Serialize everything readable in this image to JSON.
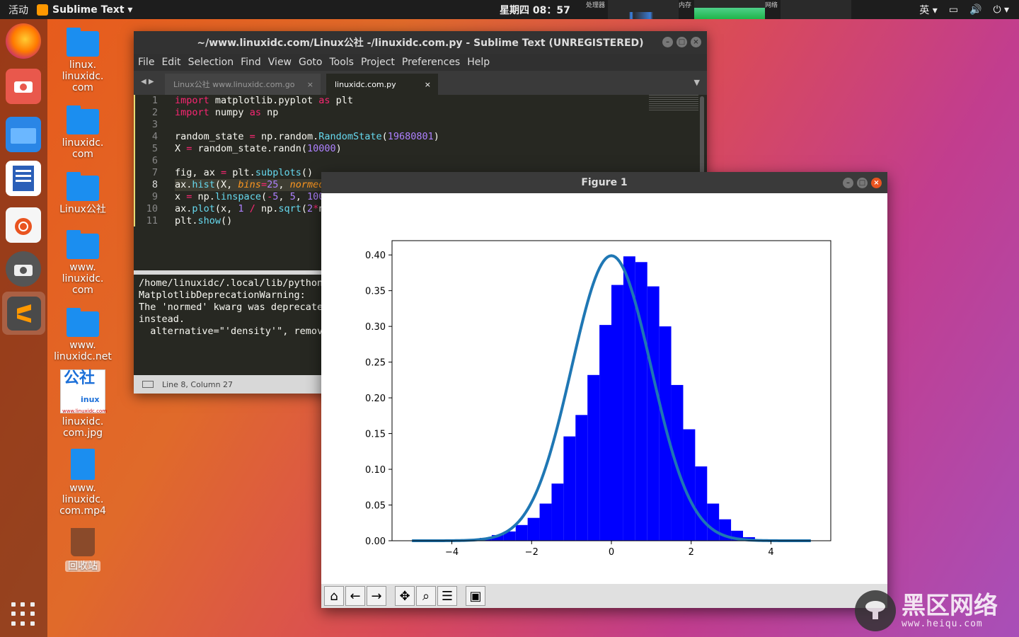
{
  "topbar": {
    "activities": "活动",
    "app_menu": "Sublime Text ▾",
    "clock": "星期四 08：57",
    "monitors": {
      "cpu": "处理器",
      "mem": "内存",
      "net": "网络"
    },
    "input_method": "英 ▾"
  },
  "desktop_icons": [
    {
      "label": "linux.\nlinuxidc.\ncom"
    },
    {
      "label": "linuxidc.\ncom"
    },
    {
      "label": "Linux公社"
    },
    {
      "label": "www.\nlinuxidc.\ncom"
    },
    {
      "label": "www.\nlinuxidc.net"
    },
    {
      "label": "linuxidc.\ncom.jpg"
    },
    {
      "label": "www.\nlinuxidc.\ncom.mp4"
    },
    {
      "label": "回收站"
    }
  ],
  "jpg_thumb": {
    "big": "公社",
    "inux": "inux",
    "url": "www.linuxidc.com"
  },
  "sublime": {
    "title": "~/www.linuxidc.com/Linux公社 -/linuxidc.com.py - Sublime Text (UNREGISTERED)",
    "menu": [
      "File",
      "Edit",
      "Selection",
      "Find",
      "View",
      "Goto",
      "Tools",
      "Project",
      "Preferences",
      "Help"
    ],
    "tabs": [
      {
        "label": "Linux公社 www.linuxidc.com.go"
      },
      {
        "label": "linuxidc.com.py"
      }
    ],
    "line_numbers": [
      "1",
      "2",
      "3",
      "4",
      "5",
      "6",
      "7",
      "8",
      "9",
      "10",
      "11"
    ],
    "console": "/home/linuxidc/.local/lib/python3\nMatplotlibDeprecationWarning:\nThe 'normed' kwarg was deprecated\ninstead.\n  alternative=\"'density'\", remova",
    "status": "Line 8, Column 27"
  },
  "figure": {
    "title": "Figure 1"
  },
  "chart_data": {
    "type": "bar",
    "title": "",
    "xlabel": "",
    "ylabel": "",
    "xlim": [
      -5.5,
      5.5
    ],
    "ylim": [
      0,
      0.42
    ],
    "xticks": [
      -4,
      -2,
      0,
      2,
      4
    ],
    "xtick_labels": [
      "−4",
      "−2",
      "0",
      "2",
      "4"
    ],
    "yticks": [
      0.0,
      0.05,
      0.1,
      0.15,
      0.2,
      0.25,
      0.3,
      0.35,
      0.4
    ],
    "ytick_labels": [
      "0.00",
      "0.05",
      "0.10",
      "0.15",
      "0.20",
      "0.25",
      "0.30",
      "0.35",
      "0.40"
    ],
    "bar_color": "#0000ff",
    "line_color": "#1f77b4",
    "histogram": {
      "bin_start": -3.9,
      "bin_width": 0.3,
      "heights": [
        0.001,
        0.002,
        0.004,
        0.008,
        0.013,
        0.022,
        0.032,
        0.052,
        0.08,
        0.146,
        0.176,
        0.232,
        0.302,
        0.358,
        0.398,
        0.39,
        0.356,
        0.3,
        0.218,
        0.156,
        0.104,
        0.052,
        0.03,
        0.014,
        0.005
      ]
    },
    "curve": {
      "x_range": [
        -5,
        5
      ],
      "formula": "1/sqrt(2*pi) * exp(-x^2/2)"
    }
  },
  "toolbar": [
    "home-icon",
    "back-icon",
    "forward-icon",
    "pan-icon",
    "zoom-icon",
    "configure-icon",
    "save-icon"
  ],
  "watermark": {
    "title": "黑区网络",
    "url": "www.heiqu.com"
  }
}
